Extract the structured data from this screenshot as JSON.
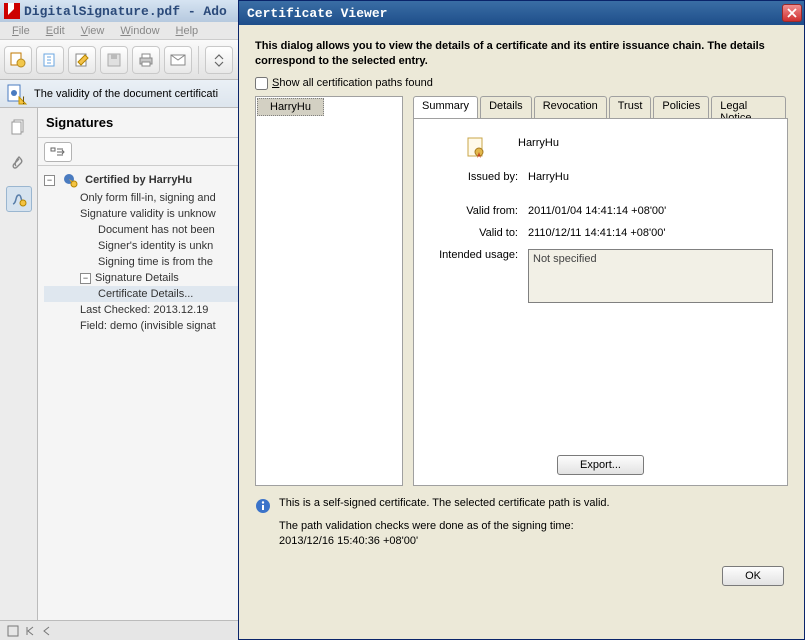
{
  "adobe": {
    "title": "DigitalSignature.pdf - Ado",
    "menus": [
      "File",
      "Edit",
      "View",
      "Window",
      "Help"
    ],
    "validity_text": "The validity of the document certificati",
    "sig_panel_title": "Signatures",
    "tree": {
      "root": "Certified by HarryHu",
      "lines": [
        "Only form fill-in, signing and",
        "Signature validity is unknow",
        "Document has not been",
        "Signer's identity is unkn",
        "Signing time is from the"
      ],
      "sigdetails_label": "Signature Details",
      "certdetails_label": "Certificate Details...",
      "lastchecked": "Last Checked: 2013.12.19",
      "field": "Field: demo (invisible signat"
    }
  },
  "dialog": {
    "title": "Certificate Viewer",
    "intro": "This dialog allows you to view the details of a certificate and its entire issuance chain. The details correspond to the selected entry.",
    "checkbox_label_pre": "S",
    "checkbox_label_rest": "how all certification paths found",
    "tree_selected": "HarryHu",
    "tabs": [
      "Summary",
      "Details",
      "Revocation",
      "Trust",
      "Policies",
      "Legal Notice"
    ],
    "summary": {
      "name": "HarryHu",
      "issued_by_label": "Issued by:",
      "issued_by": "HarryHu",
      "valid_from_label": "Valid from:",
      "valid_from": "2011/01/04 14:41:14 +08'00'",
      "valid_to_label": "Valid to:",
      "valid_to": "2110/12/11 14:41:14 +08'00'",
      "intended_label": "Intended usage:",
      "intended": "Not specified",
      "export_label": "Export..."
    },
    "footer_line1": "This is a self-signed certificate. The selected certificate path is valid.",
    "footer_line2": "The path validation checks were done as of the signing time:",
    "footer_line3": "2013/12/16 15:40:36 +08'00'",
    "ok_label": "OK"
  }
}
